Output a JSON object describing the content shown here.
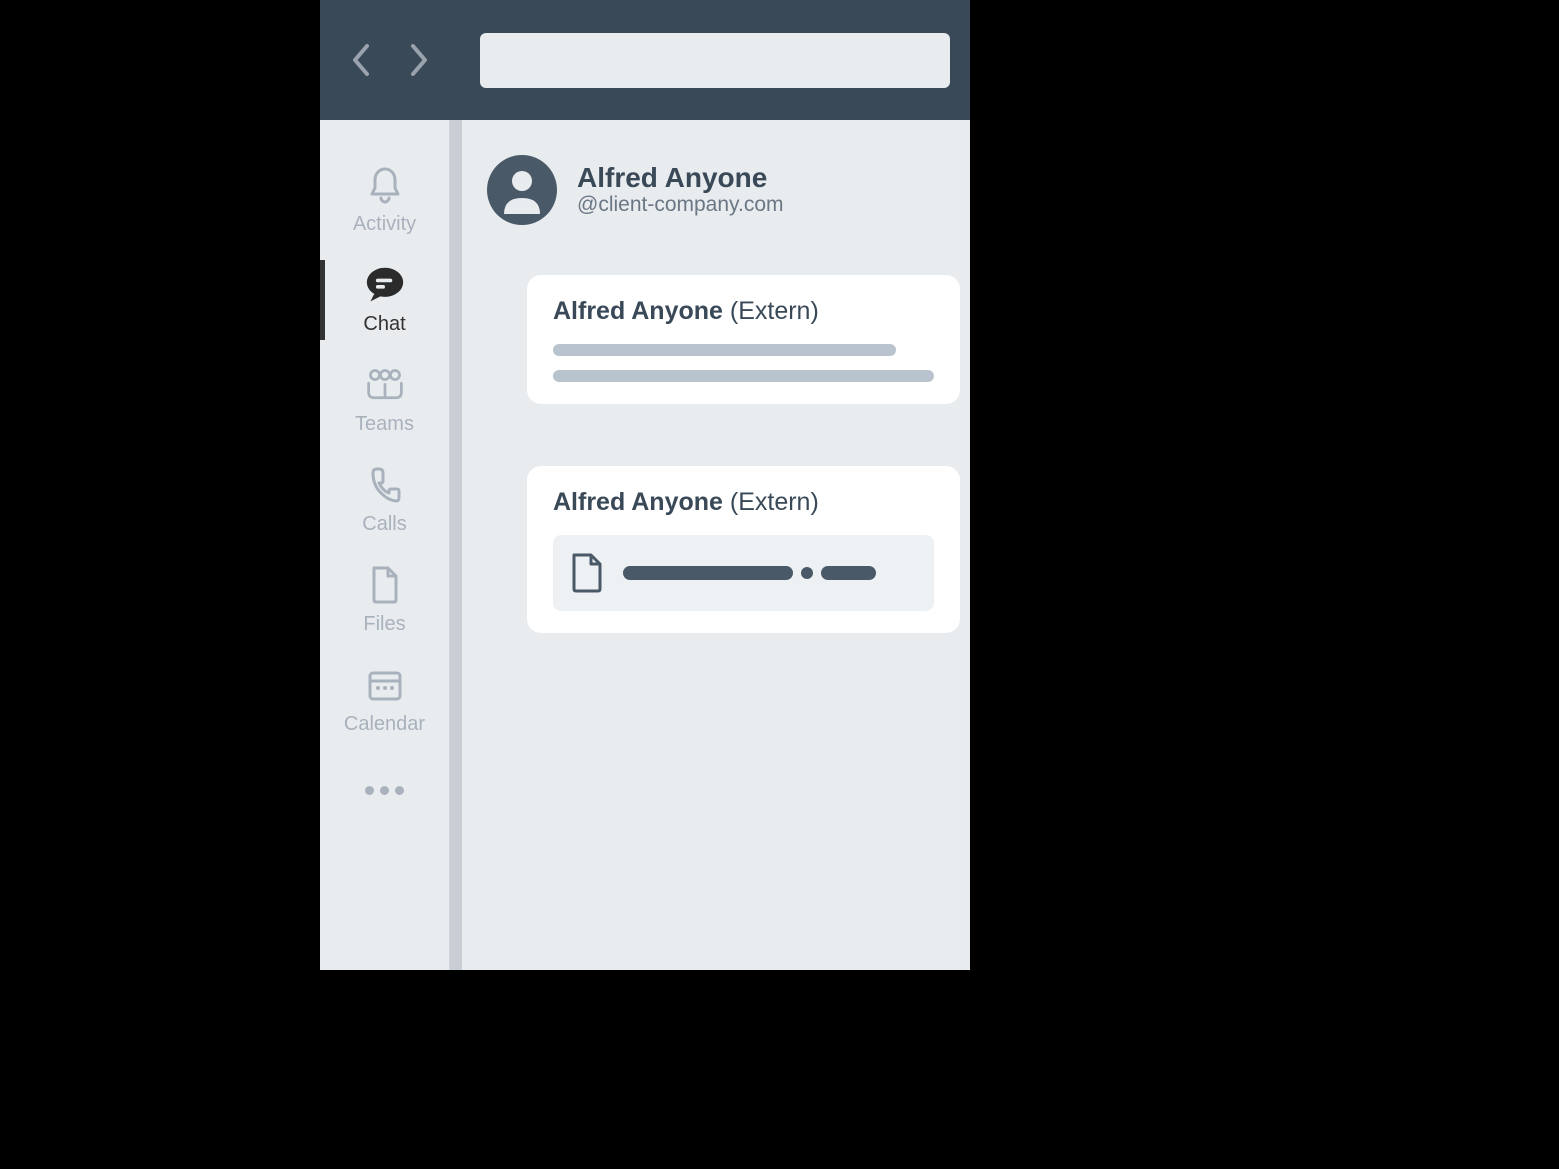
{
  "sidebar": {
    "items": [
      {
        "id": "activity",
        "label": "Activity",
        "icon": "bell",
        "active": false
      },
      {
        "id": "chat",
        "label": "Chat",
        "icon": "chat",
        "active": true
      },
      {
        "id": "teams",
        "label": "Teams",
        "icon": "teams",
        "active": false
      },
      {
        "id": "calls",
        "label": "Calls",
        "icon": "phone",
        "active": false
      },
      {
        "id": "files",
        "label": "Files",
        "icon": "file",
        "active": false
      },
      {
        "id": "calendar",
        "label": "Calendar",
        "icon": "calendar",
        "active": false
      }
    ]
  },
  "chat": {
    "contact_name": "Alfred Anyone",
    "contact_handle": "@client-company.com",
    "messages": [
      {
        "sender": "Alfred Anyone",
        "tag": "(Extern)",
        "type": "text"
      },
      {
        "sender": "Alfred Anyone",
        "tag": "(Extern)",
        "type": "file"
      }
    ]
  },
  "colors": {
    "titlebar": "#3a4958",
    "background": "#e8ecef",
    "inactive": "#a9b2bc",
    "active": "#333333",
    "avatar": "#4a5967"
  }
}
